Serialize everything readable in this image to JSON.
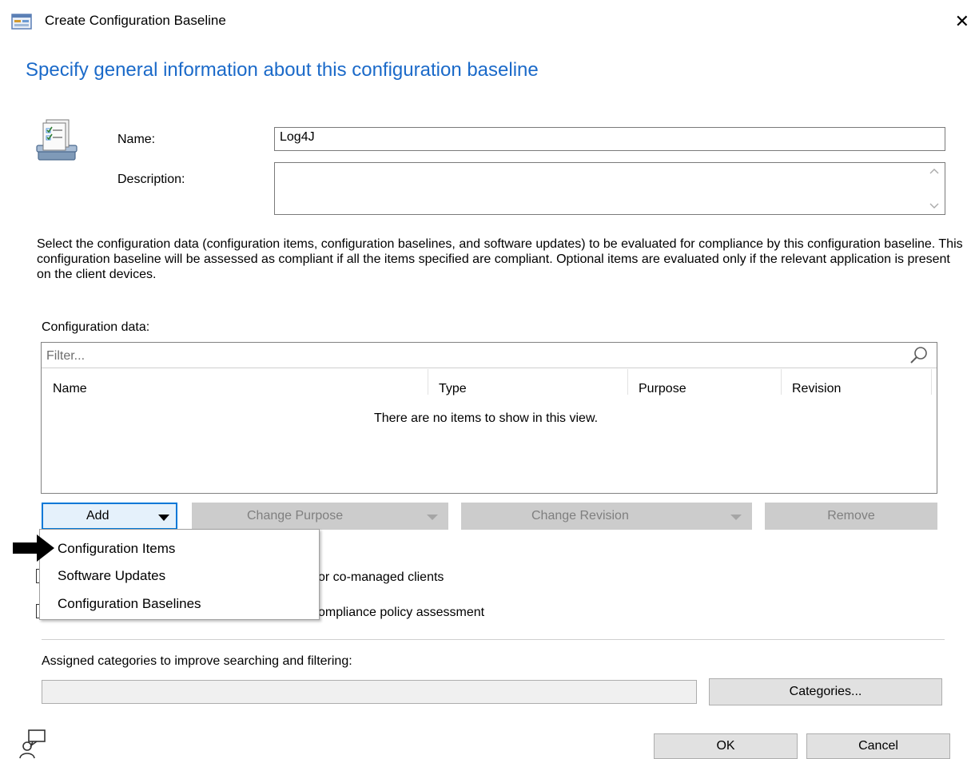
{
  "window": {
    "title": "Create Configuration Baseline",
    "close_glyph": "✕"
  },
  "page": {
    "heading": "Specify general information about this configuration baseline"
  },
  "form": {
    "name_label": "Name:",
    "name_value": "Log4J",
    "description_label": "Description:",
    "description_value": ""
  },
  "instructions": "Select the configuration data (configuration items, configuration baselines, and software updates) to be evaluated for compliance by this configuration baseline. This configuration baseline will be assessed as compliant if all the items specified are compliant. Optional items are evaluated only if the relevant application is present on  the client devices.",
  "config_data": {
    "label": "Configuration data:",
    "filter_placeholder": "Filter...",
    "columns": [
      "Name",
      "Type",
      "Purpose",
      "Revision"
    ],
    "empty_message": "There are no items to show in this view."
  },
  "buttons": {
    "add": "Add",
    "change_purpose": "Change Purpose",
    "change_revision": "Change Revision",
    "remove": "Remove",
    "categories": "Categories...",
    "ok": "OK",
    "cancel": "Cancel"
  },
  "add_menu": {
    "items": [
      "Configuration Items",
      "Software Updates",
      "Configuration Baselines"
    ]
  },
  "checkboxes": {
    "co_managed_partial": "or co-managed clients",
    "compliance_partial": "ompliance policy assessment"
  },
  "categories": {
    "label": "Assigned categories to improve searching and filtering:",
    "value": ""
  },
  "colors": {
    "heading": "#1b6ac9",
    "focus_border": "#0078d7",
    "disabled_button": "#cccccc"
  }
}
